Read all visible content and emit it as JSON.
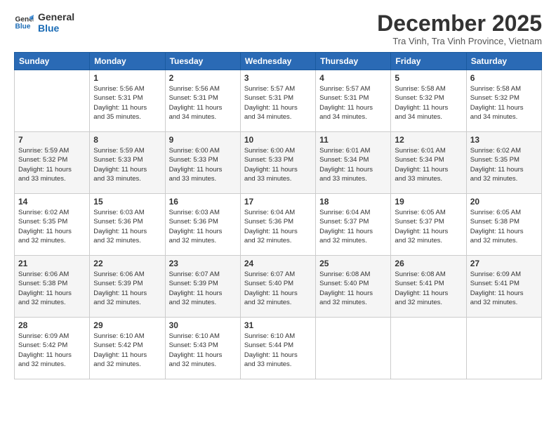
{
  "logo": {
    "line1": "General",
    "line2": "Blue"
  },
  "title": "December 2025",
  "location": "Tra Vinh, Tra Vinh Province, Vietnam",
  "days_of_week": [
    "Sunday",
    "Monday",
    "Tuesday",
    "Wednesday",
    "Thursday",
    "Friday",
    "Saturday"
  ],
  "weeks": [
    [
      {
        "num": "",
        "info": ""
      },
      {
        "num": "1",
        "info": "Sunrise: 5:56 AM\nSunset: 5:31 PM\nDaylight: 11 hours\nand 35 minutes."
      },
      {
        "num": "2",
        "info": "Sunrise: 5:56 AM\nSunset: 5:31 PM\nDaylight: 11 hours\nand 34 minutes."
      },
      {
        "num": "3",
        "info": "Sunrise: 5:57 AM\nSunset: 5:31 PM\nDaylight: 11 hours\nand 34 minutes."
      },
      {
        "num": "4",
        "info": "Sunrise: 5:57 AM\nSunset: 5:31 PM\nDaylight: 11 hours\nand 34 minutes."
      },
      {
        "num": "5",
        "info": "Sunrise: 5:58 AM\nSunset: 5:32 PM\nDaylight: 11 hours\nand 34 minutes."
      },
      {
        "num": "6",
        "info": "Sunrise: 5:58 AM\nSunset: 5:32 PM\nDaylight: 11 hours\nand 34 minutes."
      }
    ],
    [
      {
        "num": "7",
        "info": "Sunrise: 5:59 AM\nSunset: 5:32 PM\nDaylight: 11 hours\nand 33 minutes."
      },
      {
        "num": "8",
        "info": "Sunrise: 5:59 AM\nSunset: 5:33 PM\nDaylight: 11 hours\nand 33 minutes."
      },
      {
        "num": "9",
        "info": "Sunrise: 6:00 AM\nSunset: 5:33 PM\nDaylight: 11 hours\nand 33 minutes."
      },
      {
        "num": "10",
        "info": "Sunrise: 6:00 AM\nSunset: 5:33 PM\nDaylight: 11 hours\nand 33 minutes."
      },
      {
        "num": "11",
        "info": "Sunrise: 6:01 AM\nSunset: 5:34 PM\nDaylight: 11 hours\nand 33 minutes."
      },
      {
        "num": "12",
        "info": "Sunrise: 6:01 AM\nSunset: 5:34 PM\nDaylight: 11 hours\nand 33 minutes."
      },
      {
        "num": "13",
        "info": "Sunrise: 6:02 AM\nSunset: 5:35 PM\nDaylight: 11 hours\nand 32 minutes."
      }
    ],
    [
      {
        "num": "14",
        "info": "Sunrise: 6:02 AM\nSunset: 5:35 PM\nDaylight: 11 hours\nand 32 minutes."
      },
      {
        "num": "15",
        "info": "Sunrise: 6:03 AM\nSunset: 5:36 PM\nDaylight: 11 hours\nand 32 minutes."
      },
      {
        "num": "16",
        "info": "Sunrise: 6:03 AM\nSunset: 5:36 PM\nDaylight: 11 hours\nand 32 minutes."
      },
      {
        "num": "17",
        "info": "Sunrise: 6:04 AM\nSunset: 5:36 PM\nDaylight: 11 hours\nand 32 minutes."
      },
      {
        "num": "18",
        "info": "Sunrise: 6:04 AM\nSunset: 5:37 PM\nDaylight: 11 hours\nand 32 minutes."
      },
      {
        "num": "19",
        "info": "Sunrise: 6:05 AM\nSunset: 5:37 PM\nDaylight: 11 hours\nand 32 minutes."
      },
      {
        "num": "20",
        "info": "Sunrise: 6:05 AM\nSunset: 5:38 PM\nDaylight: 11 hours\nand 32 minutes."
      }
    ],
    [
      {
        "num": "21",
        "info": "Sunrise: 6:06 AM\nSunset: 5:38 PM\nDaylight: 11 hours\nand 32 minutes."
      },
      {
        "num": "22",
        "info": "Sunrise: 6:06 AM\nSunset: 5:39 PM\nDaylight: 11 hours\nand 32 minutes."
      },
      {
        "num": "23",
        "info": "Sunrise: 6:07 AM\nSunset: 5:39 PM\nDaylight: 11 hours\nand 32 minutes."
      },
      {
        "num": "24",
        "info": "Sunrise: 6:07 AM\nSunset: 5:40 PM\nDaylight: 11 hours\nand 32 minutes."
      },
      {
        "num": "25",
        "info": "Sunrise: 6:08 AM\nSunset: 5:40 PM\nDaylight: 11 hours\nand 32 minutes."
      },
      {
        "num": "26",
        "info": "Sunrise: 6:08 AM\nSunset: 5:41 PM\nDaylight: 11 hours\nand 32 minutes."
      },
      {
        "num": "27",
        "info": "Sunrise: 6:09 AM\nSunset: 5:41 PM\nDaylight: 11 hours\nand 32 minutes."
      }
    ],
    [
      {
        "num": "28",
        "info": "Sunrise: 6:09 AM\nSunset: 5:42 PM\nDaylight: 11 hours\nand 32 minutes."
      },
      {
        "num": "29",
        "info": "Sunrise: 6:10 AM\nSunset: 5:42 PM\nDaylight: 11 hours\nand 32 minutes."
      },
      {
        "num": "30",
        "info": "Sunrise: 6:10 AM\nSunset: 5:43 PM\nDaylight: 11 hours\nand 32 minutes."
      },
      {
        "num": "31",
        "info": "Sunrise: 6:10 AM\nSunset: 5:44 PM\nDaylight: 11 hours\nand 33 minutes."
      },
      {
        "num": "",
        "info": ""
      },
      {
        "num": "",
        "info": ""
      },
      {
        "num": "",
        "info": ""
      }
    ]
  ]
}
